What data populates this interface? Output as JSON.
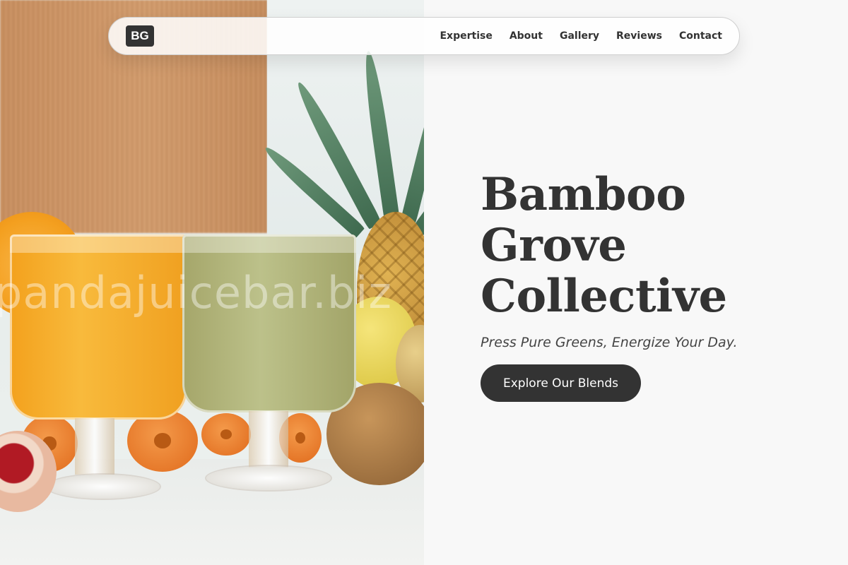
{
  "navbar": {
    "logo_text": "BG",
    "links": [
      {
        "label": "Expertise"
      },
      {
        "label": "About"
      },
      {
        "label": "Gallery"
      },
      {
        "label": "Reviews"
      },
      {
        "label": "Contact"
      }
    ]
  },
  "hero": {
    "title_lines": [
      "Bamboo",
      "Grove",
      "Collective"
    ],
    "tagline": "Press Pure Greens, Energize Your Day.",
    "cta_label": "Explore Our Blends"
  },
  "image": {
    "watermark_text": "pandajuicebar.biz"
  },
  "colors": {
    "primary": "#333333",
    "background": "#f8f8f8",
    "cta_text": "#ffffff"
  }
}
